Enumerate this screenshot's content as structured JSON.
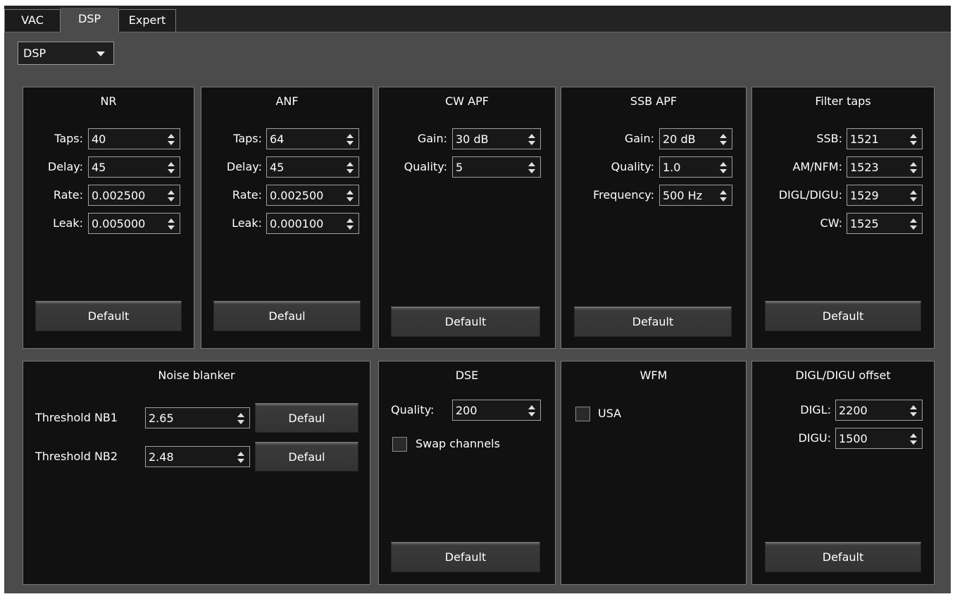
{
  "tabs": [
    {
      "label": "VAC",
      "active": false
    },
    {
      "label": "DSP",
      "active": true
    },
    {
      "label": "Expert",
      "active": false
    }
  ],
  "combo": {
    "value": "DSP"
  },
  "panels": {
    "nr": {
      "title": "NR",
      "fields": [
        {
          "label": "Taps:",
          "value": "40"
        },
        {
          "label": "Delay:",
          "value": "45"
        },
        {
          "label": "Rate:",
          "value": "0.002500"
        },
        {
          "label": "Leak:",
          "value": "0.005000"
        }
      ],
      "button": "Default"
    },
    "anf": {
      "title": "ANF",
      "fields": [
        {
          "label": "Taps:",
          "value": "64"
        },
        {
          "label": "Delay:",
          "value": "45"
        },
        {
          "label": "Rate:",
          "value": "0.002500"
        },
        {
          "label": "Leak:",
          "value": "0.000100"
        }
      ],
      "button": "Defaul"
    },
    "cw_apf": {
      "title": "CW APF",
      "fields": [
        {
          "label": "Gain:",
          "value": "30 dB"
        },
        {
          "label": "Quality:",
          "value": "5"
        }
      ],
      "button": "Default"
    },
    "ssb_apf": {
      "title": "SSB APF",
      "fields": [
        {
          "label": "Gain:",
          "value": "20 dB"
        },
        {
          "label": "Quality:",
          "value": "1.0"
        },
        {
          "label": "Frequency:",
          "value": "500 Hz"
        }
      ],
      "button": "Default"
    },
    "filter_taps": {
      "title": "Filter taps",
      "fields": [
        {
          "label": "SSB:",
          "value": "1521"
        },
        {
          "label": "AM/NFM:",
          "value": "1523"
        },
        {
          "label": "DIGL/DIGU:",
          "value": "1529"
        },
        {
          "label": "CW:",
          "value": "1525"
        }
      ],
      "button": "Default"
    },
    "noise_blanker": {
      "title": "Noise blanker",
      "fields": [
        {
          "label": "Threshold NB1",
          "value": "2.65",
          "button": "Defaul"
        },
        {
          "label": "Threshold NB2",
          "value": "2.48",
          "button": "Defaul"
        }
      ]
    },
    "dse": {
      "title": "DSE",
      "fields": [
        {
          "label": "Quality:",
          "value": "200"
        }
      ],
      "checkbox": {
        "label": "Swap channels",
        "checked": false
      },
      "button": "Default"
    },
    "wfm": {
      "title": "WFM",
      "checkbox": {
        "label": "USA",
        "checked": false
      }
    },
    "digl_digu_offset": {
      "title": "DIGL/DIGU offset",
      "fields": [
        {
          "label": "DIGL:",
          "value": "2200"
        },
        {
          "label": "DIGU:",
          "value": "1500"
        }
      ],
      "button": "Default"
    }
  }
}
